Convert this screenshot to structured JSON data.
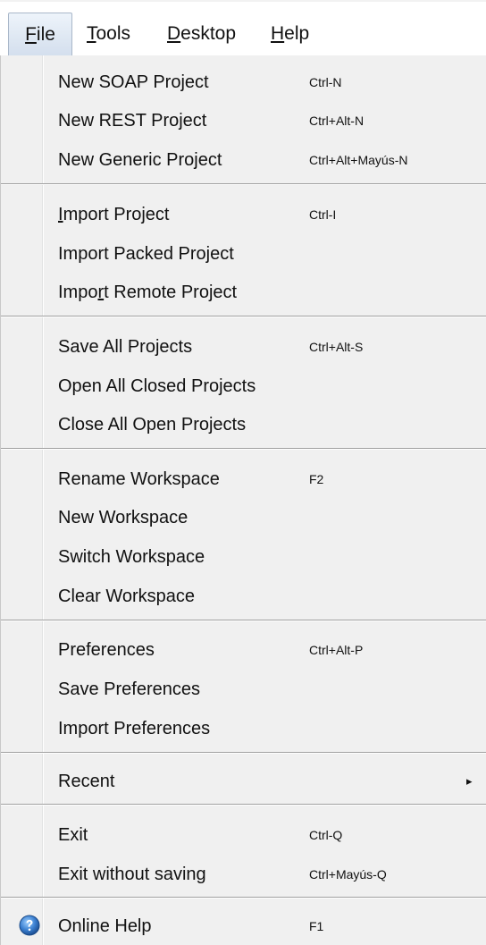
{
  "menubar": {
    "file_pre": "",
    "file_u": "F",
    "file_post": "ile",
    "tools_pre": "",
    "tools_u": "T",
    "tools_post": "ools",
    "desktop_pre": "",
    "desktop_u": "D",
    "desktop_post": "esktop",
    "help_pre": "",
    "help_u": "H",
    "help_post": "elp"
  },
  "menu": {
    "new_soap": {
      "label": "New SOAP Project",
      "shortcut": "Ctrl-N"
    },
    "new_rest": {
      "label": "New REST Project",
      "shortcut": "Ctrl+Alt-N"
    },
    "new_generic": {
      "label": "New Generic Project",
      "shortcut": "Ctrl+Alt+Mayús-N"
    },
    "import_project": {
      "label_u": "I",
      "label_rest": "mport Project",
      "shortcut": "Ctrl-I"
    },
    "import_packed": {
      "label": "Import Packed Project"
    },
    "import_remote": {
      "label_pre": "Impo",
      "label_u": "r",
      "label_post": "t Remote Project"
    },
    "save_all": {
      "label": "Save All Projects",
      "shortcut": "Ctrl+Alt-S"
    },
    "open_all_closed": {
      "label": "Open All Closed Projects"
    },
    "close_all_open": {
      "label": "Close All Open Projects"
    },
    "rename_ws": {
      "label": "Rename Workspace",
      "shortcut": "F2"
    },
    "new_ws": {
      "label": "New Workspace"
    },
    "switch_ws": {
      "label": "Switch Workspace"
    },
    "clear_ws": {
      "label": "Clear Workspace"
    },
    "preferences": {
      "label": "Preferences",
      "shortcut": "Ctrl+Alt-P"
    },
    "save_prefs": {
      "label": "Save Preferences"
    },
    "import_prefs": {
      "label": "Import Preferences"
    },
    "recent": {
      "label": "Recent",
      "arrow": "▸"
    },
    "exit": {
      "label": "Exit",
      "shortcut": "Ctrl-Q"
    },
    "exit_nosave": {
      "label": "Exit without saving",
      "shortcut": "Ctrl+Mayús-Q"
    },
    "online_help": {
      "label": "Online Help",
      "shortcut": "F1",
      "icon": "help-globe-icon"
    }
  },
  "colors": {
    "menu_bg": "#f0f0f0",
    "active_tab": "#dfe8f3",
    "icon_blue": "#2f6fbf"
  }
}
